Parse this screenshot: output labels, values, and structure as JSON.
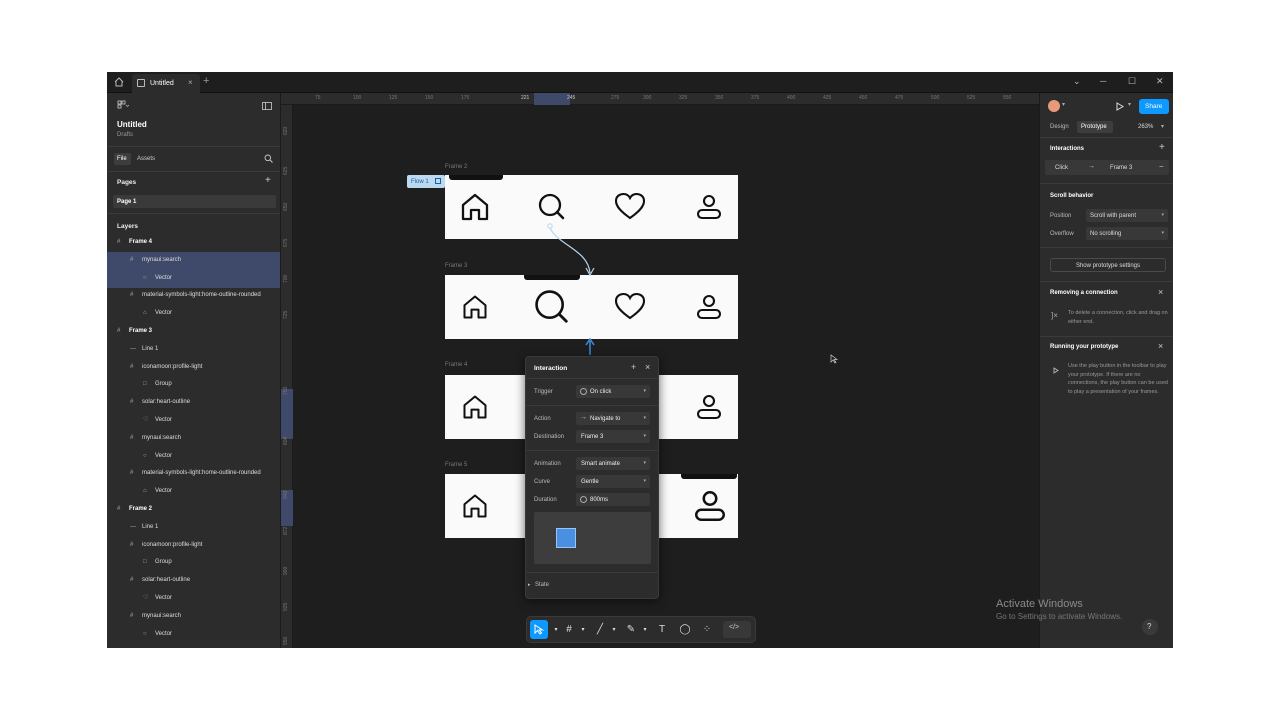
{
  "titlebar": {
    "tab_title": "Untitled",
    "tab_close": "×",
    "new_tab": "+",
    "minimize": "─",
    "maximize": "☐",
    "close": "✕",
    "chevron": "⌄"
  },
  "left_panel": {
    "file_name": "Untitled",
    "location": "Drafts",
    "tabs": [
      "File",
      "Assets"
    ],
    "pages_title": "Pages",
    "pages_add": "+",
    "page_item": "Page 1",
    "layers_title": "Layers",
    "layers": [
      {
        "label": "Frame 4",
        "icon": "#",
        "depth": 0,
        "bold": true,
        "selected": false
      },
      {
        "label": "mynaui:search",
        "icon": "#",
        "depth": 1,
        "bold": false,
        "selected": true
      },
      {
        "label": "Vector",
        "icon": "○",
        "depth": 2,
        "bold": false,
        "selected": true
      },
      {
        "label": "material-symbols-light:home-outline-rounded",
        "icon": "#",
        "depth": 1,
        "bold": false,
        "selected": false
      },
      {
        "label": "Vector",
        "icon": "⌂",
        "depth": 2,
        "bold": false,
        "selected": false
      },
      {
        "label": "Frame 3",
        "icon": "#",
        "depth": 0,
        "bold": true,
        "selected": false
      },
      {
        "label": "Line 1",
        "icon": "—",
        "depth": 1,
        "bold": false,
        "selected": false
      },
      {
        "label": "iconamoon:profile-light",
        "icon": "#",
        "depth": 1,
        "bold": false,
        "selected": false
      },
      {
        "label": "Group",
        "icon": "□",
        "depth": 2,
        "bold": false,
        "selected": false
      },
      {
        "label": "solar:heart-outline",
        "icon": "#",
        "depth": 1,
        "bold": false,
        "selected": false
      },
      {
        "label": "Vector",
        "icon": "♡",
        "depth": 2,
        "bold": false,
        "selected": false
      },
      {
        "label": "mynaui:search",
        "icon": "#",
        "depth": 1,
        "bold": false,
        "selected": false
      },
      {
        "label": "Vector",
        "icon": "○",
        "depth": 2,
        "bold": false,
        "selected": false
      },
      {
        "label": "material-symbols-light:home-outline-rounded",
        "icon": "#",
        "depth": 1,
        "bold": false,
        "selected": false
      },
      {
        "label": "Vector",
        "icon": "⌂",
        "depth": 2,
        "bold": false,
        "selected": false
      },
      {
        "label": "Frame 2",
        "icon": "#",
        "depth": 0,
        "bold": true,
        "selected": false
      },
      {
        "label": "Line 1",
        "icon": "—",
        "depth": 1,
        "bold": false,
        "selected": false
      },
      {
        "label": "iconamoon:profile-light",
        "icon": "#",
        "depth": 1,
        "bold": false,
        "selected": false
      },
      {
        "label": "Group",
        "icon": "□",
        "depth": 2,
        "bold": false,
        "selected": false
      },
      {
        "label": "solar:heart-outline",
        "icon": "#",
        "depth": 1,
        "bold": false,
        "selected": false
      },
      {
        "label": "Vector",
        "icon": "♡",
        "depth": 2,
        "bold": false,
        "selected": false
      },
      {
        "label": "mynaui:search",
        "icon": "#",
        "depth": 1,
        "bold": false,
        "selected": false
      },
      {
        "label": "Vector",
        "icon": "○",
        "depth": 2,
        "bold": false,
        "selected": false
      }
    ]
  },
  "ruler": {
    "top": [
      "75",
      "100",
      "125",
      "150",
      "175",
      "221",
      "245",
      "275",
      "300",
      "325",
      "350",
      "375",
      "400",
      "425",
      "450",
      "475",
      "500",
      "525",
      "550"
    ],
    "left": [
      "620",
      "625",
      "650",
      "675",
      "700",
      "725",
      "750",
      "804",
      "848",
      "872",
      "900",
      "925",
      "950"
    ]
  },
  "canvas": {
    "flow_label": "Flow 1",
    "frames": [
      {
        "label": "Frame 2"
      },
      {
        "label": "Frame 3"
      },
      {
        "label": "Frame 4"
      },
      {
        "label": "Frame 5"
      }
    ]
  },
  "interaction": {
    "title": "Interaction",
    "add": "+",
    "close": "×",
    "trigger_label": "Trigger",
    "trigger_value": "On click",
    "action_label": "Action",
    "action_value": "Navigate to",
    "destination_label": "Destination",
    "destination_value": "Frame 3",
    "animation_label": "Animation",
    "animation_value": "Smart animate",
    "curve_label": "Curve",
    "curve_value": "Gentle",
    "duration_label": "Duration",
    "duration_value": "800ms",
    "state_label": "State",
    "preview_color": "#4a90e2"
  },
  "right_panel": {
    "share": "Share",
    "tabs": [
      "Design",
      "Prototype"
    ],
    "zoom": "263%",
    "interactions_title": "Interactions",
    "interaction_trigger": "Click",
    "interaction_target": "Frame 3",
    "scroll_title": "Scroll behavior",
    "position_label": "Position",
    "position_value": "Scroll with parent",
    "overflow_label": "Overflow",
    "overflow_value": "No scrolling",
    "settings_button": "Show prototype settings",
    "removing_title": "Removing a connection",
    "removing_text": "To delete a connection, click and drag on either end.",
    "running_title": "Running your prototype",
    "running_text": "Use the play button in the toolbar to play your prototype. If there are no connections, the play button can be used to play a presentation of your frames.",
    "accent": "#0d99ff"
  },
  "watermark": {
    "line1": "Activate Windows",
    "line2": "Go to Settings to activate Windows."
  },
  "help": "?"
}
